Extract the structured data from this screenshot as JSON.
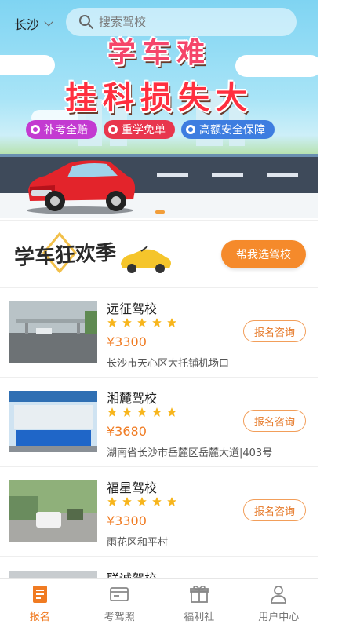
{
  "header": {
    "city": "长沙",
    "search_placeholder": "搜索驾校"
  },
  "banner": {
    "line1": "学车难",
    "line2": "挂科损失大",
    "tags": [
      "补考全赔",
      "重学免单",
      "高额安全保障"
    ],
    "carousel_dots": 1
  },
  "promo": {
    "logo_text": "学车狂欢季",
    "button_label": "帮我选驾校"
  },
  "schools": [
    {
      "name": "远征驾校",
      "stars": 5,
      "price": "¥3300",
      "address": "长沙市天心区大托铺机场口",
      "button": "报名咨询"
    },
    {
      "name": "湘麓驾校",
      "stars": 5,
      "price": "¥3680",
      "address": "湖南省长沙市岳麓区岳麓大道|403号",
      "button": "报名咨询"
    },
    {
      "name": "福星驾校",
      "stars": 5,
      "price": "¥3300",
      "address": "雨花区和平村",
      "button": "报名咨询"
    }
  ],
  "partial_school": {
    "name": "联诚驾校"
  },
  "tabbar": [
    {
      "label": "报名",
      "active": true
    },
    {
      "label": "考驾照",
      "active": false
    },
    {
      "label": "福利社",
      "active": false
    },
    {
      "label": "用户中心",
      "active": false
    }
  ],
  "colors": {
    "accent": "#f07b22",
    "star": "#f7b51c"
  }
}
